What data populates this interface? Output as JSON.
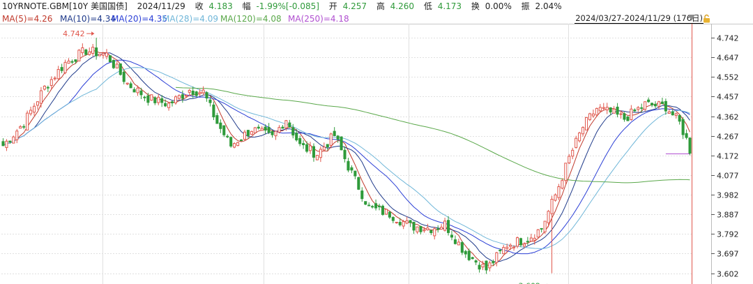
{
  "header": {
    "symbol": "10YRNOTE.GBM[10Y 美国国债]",
    "date": "2024/11/29",
    "close_label": "收",
    "close_value": "4.183",
    "change_label": "幅",
    "change_value": "-1.99%[-0.085]",
    "open_label": "开",
    "open_value": "4.257",
    "high_label": "高",
    "high_value": "4.260",
    "low_label": "低",
    "low_value": "4.173",
    "turnover_label": "换",
    "turnover_value": "0.00%",
    "amplitude_label": "振",
    "amplitude_value": "2.04%"
  },
  "ma_legend": [
    {
      "text": "MA(5)=4.26",
      "color": "#c0392b"
    },
    {
      "text": "MA(10)=4.34",
      "color": "#1f3a8a"
    },
    {
      "text": "MA(20)=4.35",
      "color": "#2b3fd6"
    },
    {
      "text": "MA(28)=4.09",
      "color": "#6fb6d8"
    },
    {
      "text": "MA(120)=4.08",
      "color": "#5aa84a"
    },
    {
      "text": "MA(250)=4.18",
      "color": "#b04fd0"
    }
  ],
  "date_range": "2024/03/27-2024/11/29 (176日)",
  "icons": {
    "dropdown": "triangle-down-icon",
    "lock": "lock-icon"
  },
  "colors": {
    "up": "#e0564b",
    "down": "#2f9a3a",
    "grid": "#e0e0e0",
    "cursor": "#e0564b"
  },
  "chart_data": {
    "type": "candlestick",
    "ylim": [
      3.56,
      4.81
    ],
    "y_ticks": [
      "4.742",
      "4.647",
      "4.552",
      "4.457",
      "4.362",
      "4.267",
      "4.172",
      "4.077",
      "3.982",
      "3.887",
      "3.792",
      "3.697",
      "3.602"
    ],
    "x_count": 176,
    "annotations": [
      {
        "text": "4.742",
        "index": 24,
        "value": 4.742,
        "kind": "high"
      },
      {
        "text": "3.602",
        "index": 140,
        "value": 3.602,
        "kind": "low"
      }
    ],
    "ma_last_values": {
      "MA(5)": 4.26,
      "MA(10)": 4.34,
      "MA(20)": 4.35,
      "MA(28)": 4.09,
      "MA(120)": 4.08,
      "MA(250)": 4.18
    },
    "anchors": [
      [
        0,
        4.22
      ],
      [
        6,
        4.33
      ],
      [
        12,
        4.5
      ],
      [
        18,
        4.62
      ],
      [
        24,
        4.68
      ],
      [
        30,
        4.66
      ],
      [
        36,
        4.52
      ],
      [
        42,
        4.45
      ],
      [
        48,
        4.42
      ],
      [
        54,
        4.49
      ],
      [
        58,
        4.48
      ],
      [
        62,
        4.33
      ],
      [
        66,
        4.22
      ],
      [
        72,
        4.3
      ],
      [
        78,
        4.26
      ],
      [
        82,
        4.35
      ],
      [
        86,
        4.22
      ],
      [
        91,
        4.18
      ],
      [
        96,
        4.27
      ],
      [
        100,
        4.12
      ],
      [
        106,
        3.92
      ],
      [
        112,
        3.89
      ],
      [
        118,
        3.83
      ],
      [
        124,
        3.82
      ],
      [
        128,
        3.84
      ],
      [
        134,
        3.7
      ],
      [
        140,
        3.62
      ],
      [
        146,
        3.74
      ],
      [
        152,
        3.77
      ],
      [
        156,
        3.82
      ],
      [
        160,
        3.98
      ],
      [
        164,
        4.16
      ],
      [
        168,
        4.31
      ],
      [
        172,
        4.4
      ],
      [
        176,
        4.38
      ],
      [
        180,
        4.35
      ],
      [
        186,
        4.42
      ],
      [
        192,
        4.41
      ],
      [
        196,
        4.33
      ],
      [
        199,
        4.21
      ]
    ],
    "last": {
      "open": 4.257,
      "high": 4.26,
      "low": 4.173,
      "close": 4.183
    }
  }
}
